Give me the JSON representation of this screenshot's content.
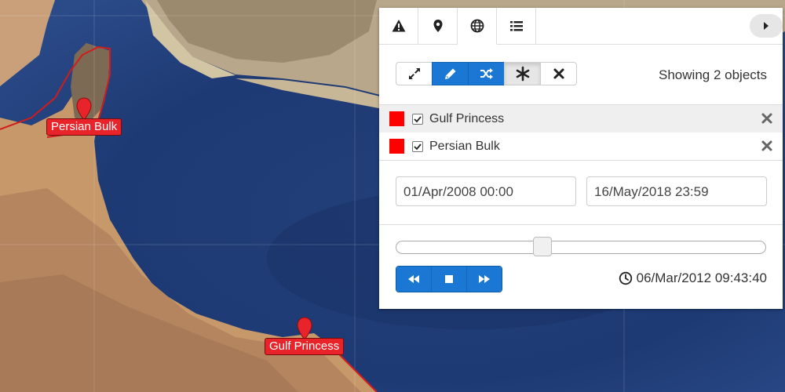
{
  "map": {
    "markers": [
      {
        "label": "Persian Bulk",
        "color": "#e8242a"
      },
      {
        "label": "Gulf Princess",
        "color": "#e8242a"
      }
    ]
  },
  "panel": {
    "tabs": [
      {
        "icon": "warning-icon"
      },
      {
        "icon": "map-pin-icon"
      },
      {
        "icon": "globe-icon",
        "active": true
      },
      {
        "icon": "list-icon"
      }
    ],
    "collapse_icon": "play-right-icon",
    "toolbar": {
      "buttons": [
        "expand-icon",
        "pencil-icon",
        "shuffle-icon",
        "asterisk-icon",
        "close-icon"
      ],
      "accent": "#1a78d4"
    },
    "showing_text": "Showing 2 objects",
    "objects": [
      {
        "name": "Gulf Princess",
        "color": "#ff0000",
        "checked": true
      },
      {
        "name": "Persian Bulk",
        "color": "#ff0000",
        "checked": true
      }
    ],
    "date_from": "01/Apr/2008 00:00",
    "date_to": "16/May/2018 23:59",
    "slider_position": 0.39,
    "playback": [
      "rewind-icon",
      "stop-icon",
      "fast-forward-icon"
    ],
    "current_time": "06/Mar/2012 09:43:40"
  }
}
